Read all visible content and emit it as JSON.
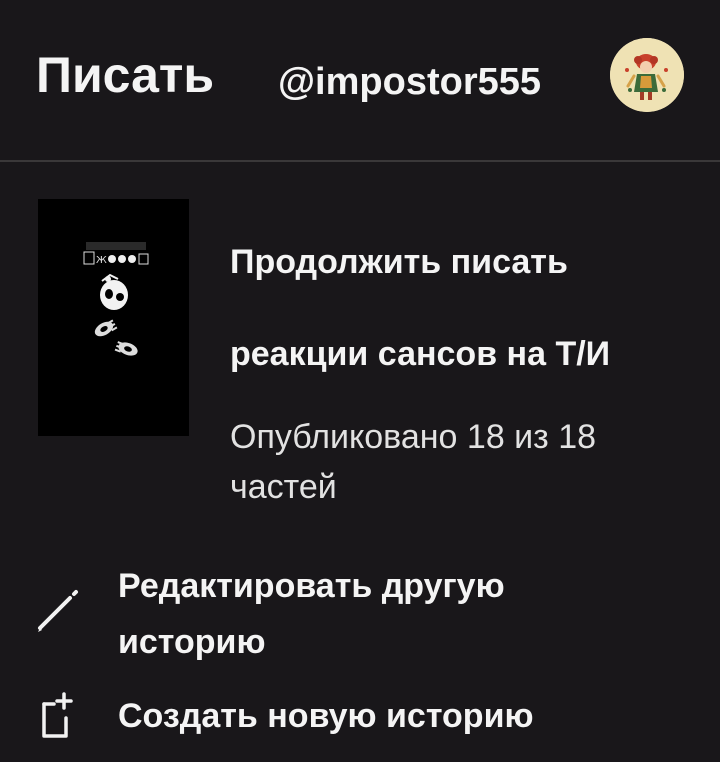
{
  "header": {
    "title": "Писать",
    "username": "@impostor555"
  },
  "continue_section": {
    "action_label": "Продолжить писать",
    "story_title": "реакции сансов на Т/И",
    "published_status": "Опубликовано 18 из 18 частей"
  },
  "actions": {
    "edit_other": "Редактировать другую историю",
    "create_new": "Создать новую историю"
  },
  "icons": {
    "edit": "pencil-icon",
    "create": "new-document-icon"
  },
  "colors": {
    "background": "#19171a",
    "text": "#f4f4f4",
    "divider": "#3a3839",
    "avatar_bg": "#efe2b4"
  }
}
